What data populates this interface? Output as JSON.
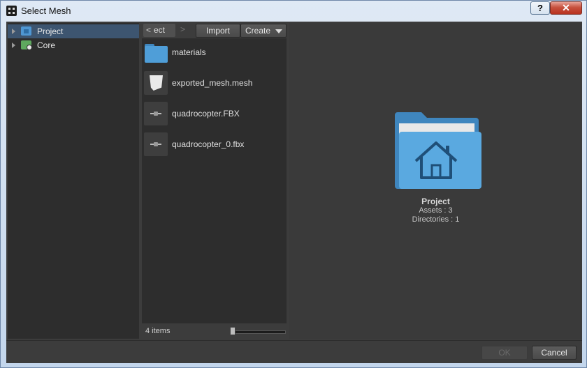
{
  "window": {
    "title": "Select Mesh",
    "help_label": "?",
    "close_label": "✕"
  },
  "tree": {
    "items": [
      {
        "label": "Project",
        "icon": "project-folder-icon",
        "selected": true
      },
      {
        "label": "Core",
        "icon": "core-package-icon",
        "selected": false
      }
    ]
  },
  "toolbar": {
    "back_label": "<",
    "breadcrumb": "ect",
    "forward_label": ">",
    "import_label": "Import",
    "create_label": "Create"
  },
  "files": [
    {
      "name": "materials",
      "icon": "folder-icon"
    },
    {
      "name": "exported_mesh.mesh",
      "icon": "mesh-icon"
    },
    {
      "name": "quadrocopter.FBX",
      "icon": "model-icon"
    },
    {
      "name": "quadrocopter_0.fbx",
      "icon": "model-icon"
    }
  ],
  "status": {
    "item_count": "4 items",
    "zoom_fraction": 0.0
  },
  "preview": {
    "title": "Project",
    "assets": "Assets : 3",
    "directories": "Directories : 1",
    "icon": "project-home-folder-icon"
  },
  "buttons": {
    "ok_label": "OK",
    "cancel_label": "Cancel"
  },
  "colors": {
    "selection": "#3d5570",
    "folder": "#4f9ed8",
    "panel": "#2d2d2d",
    "chrome": "#3c3c3c"
  }
}
